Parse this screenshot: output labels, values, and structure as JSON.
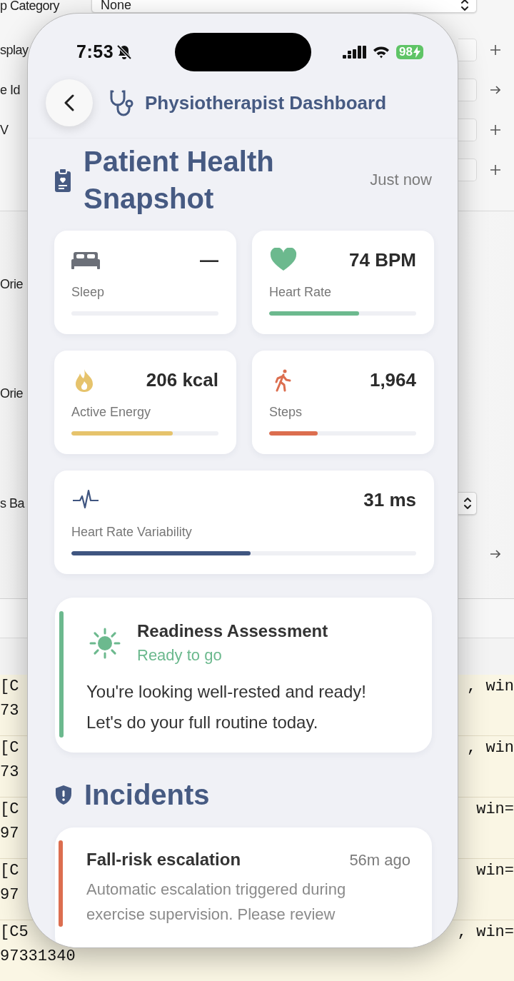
{
  "background": {
    "inspector_rows": [
      {
        "kind": "select",
        "label": "p Category",
        "value": "None"
      },
      {
        "kind": "field-add",
        "label": "splay"
      },
      {
        "kind": "field-link",
        "label": "e Id"
      },
      {
        "kind": "field-add",
        "label": "V"
      },
      {
        "kind": "field-add"
      }
    ],
    "options": [
      {
        "kind": "label",
        "label": "Orie"
      },
      {
        "kind": "label",
        "label": "Orie"
      },
      {
        "kind": "select",
        "label": "s Ba"
      },
      {
        "kind": "arrow"
      }
    ],
    "log_rows": [
      {
        "lines": [
          "[C",
          "73"
        ],
        "right": ", win"
      },
      {
        "lines": [
          "[C",
          "73"
        ],
        "right": ", win"
      },
      {
        "lines": [
          "[C",
          "97"
        ],
        "right": "win="
      },
      {
        "lines": [
          "[C",
          "97"
        ],
        "right": "win="
      },
      {
        "lines": [
          "[C5",
          "97331340"
        ],
        "right": ", win="
      }
    ]
  },
  "phone": {
    "status_bar": {
      "time": "7:53",
      "silenced": true,
      "battery": "98",
      "charging": true
    },
    "nav": {
      "title": "Physiotherapist Dashboard"
    },
    "snapshot": {
      "title": "Patient Health Snapshot",
      "updated": "Just now"
    },
    "metrics": [
      {
        "kind": "sleep",
        "label": "Sleep",
        "value": "—",
        "level": 0,
        "color": "#6b6f78"
      },
      {
        "kind": "heart",
        "label": "Heart Rate",
        "value": "74 BPM",
        "level": 0.61,
        "color": "#6cb98e"
      },
      {
        "kind": "energy",
        "label": "Active Energy",
        "value": "206 kcal",
        "level": 0.69,
        "color": "#e6c36c"
      },
      {
        "kind": "steps",
        "label": "Steps",
        "value": "1,964",
        "level": 0.33,
        "color": "#dc6e4f"
      },
      {
        "kind": "hrv",
        "label": "Heart Rate Variability",
        "value": "31 ms",
        "level": 0.52,
        "color": "#3f5580"
      }
    ],
    "readiness": {
      "title": "Readiness Assessment",
      "status": "Ready to go",
      "color": "#6cb98e",
      "message": "You're looking well-rested and ready! Let's do your full routine today."
    },
    "incidents": {
      "title": "Incidents",
      "items": [
        {
          "title": "Fall-risk escalation",
          "time": "56m ago",
          "color": "#dc6e4f",
          "description": "Automatic escalation triggered during exercise supervision. Please review"
        }
      ]
    }
  }
}
